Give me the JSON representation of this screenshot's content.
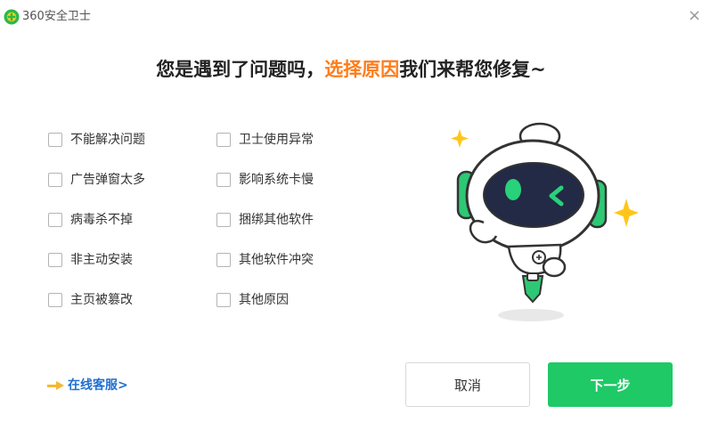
{
  "window": {
    "title": "360安全卫士",
    "close_glyph": "×",
    "logo_icon": "360-shield-logo-icon",
    "brand_color": "#1fc966"
  },
  "headline": {
    "prefix": "您是遇到了问题吗，",
    "highlight": "选择原因",
    "suffix": "我们来帮您修复~",
    "highlight_color": "#ff7c19"
  },
  "options": {
    "left": [
      {
        "label": "不能解决问题",
        "checked": false
      },
      {
        "label": "广告弹窗太多",
        "checked": false
      },
      {
        "label": "病毒杀不掉",
        "checked": false
      },
      {
        "label": "非主动安装",
        "checked": false
      },
      {
        "label": "主页被篡改",
        "checked": false
      }
    ],
    "right": [
      {
        "label": "卫士使用异常",
        "checked": false
      },
      {
        "label": "影响系统卡慢",
        "checked": false
      },
      {
        "label": "捆绑其他软件",
        "checked": false
      },
      {
        "label": "其他软件冲突",
        "checked": false
      },
      {
        "label": "其他原因",
        "checked": false
      }
    ]
  },
  "mascot": {
    "icon": "robot-mascot-illustration",
    "sparkle_icon": "sparkle-icon"
  },
  "footer": {
    "service_icon": "pointing-hand-icon",
    "service_label": "在线客服>",
    "cancel_label": "取消",
    "next_label": "下一步",
    "next_color": "#1fc966"
  }
}
